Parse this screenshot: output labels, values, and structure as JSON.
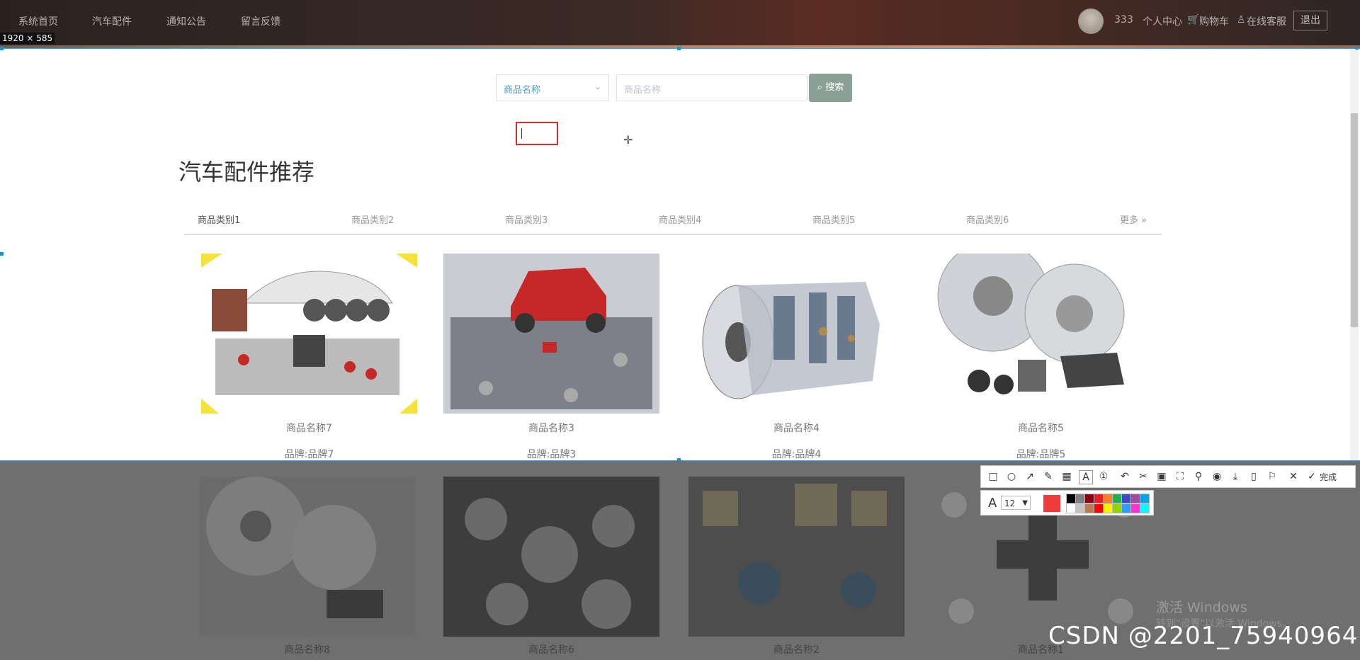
{
  "size_tag": "1920 × 585",
  "nav": {
    "items": [
      "系统首页",
      "汽车配件",
      "通知公告",
      "留言反馈"
    ],
    "username": "333",
    "profile": "个人中心",
    "cart": "购物车",
    "service": "在线客服",
    "logout": "退出"
  },
  "search": {
    "select_value": "商品名称",
    "input_placeholder": "商品名称",
    "button_label": "搜索"
  },
  "section_title": "汽车配件推荐",
  "tabs": [
    "商品类别1",
    "商品类别2",
    "商品类别3",
    "商品类别4",
    "商品类别5",
    "商品类别6"
  ],
  "more_label": "更多",
  "products": [
    {
      "name": "商品名称7",
      "brand": "品牌:品牌7",
      "icon": "car-parts-image"
    },
    {
      "name": "商品名称3",
      "brand": "品牌:品牌3",
      "icon": "red-car-parts-image"
    },
    {
      "name": "商品名称4",
      "brand": "品牌:品牌4",
      "icon": "turbine-engine-image"
    },
    {
      "name": "商品名称5",
      "brand": "品牌:品牌5",
      "icon": "brake-disc-image"
    }
  ],
  "dim_products": [
    {
      "name": "商品名称8"
    },
    {
      "name": "商品名称6"
    },
    {
      "name": "商品名称2"
    },
    {
      "name": "商品名称1"
    }
  ],
  "toolbar": {
    "done_label": "完成",
    "font_size": "12",
    "current_color": "#ee3b3b",
    "swatches": [
      "#000000",
      "#7f7f7f",
      "#880015",
      "#ed1c24",
      "#ff7f27",
      "#22b14c",
      "#3f48cc",
      "#a349a4",
      "#00a2e8",
      "#ffffff",
      "#c3c3c3",
      "#b97a57",
      "#ff0000",
      "#fff200",
      "#8fd400",
      "#3399ff",
      "#ff33cc",
      "#00ffff"
    ]
  },
  "watermark": {
    "windows_line1": "激活 Windows",
    "windows_line2": "转到\"设置\"以激活 Windows。",
    "csdn": "CSDN @2201_75940964"
  }
}
